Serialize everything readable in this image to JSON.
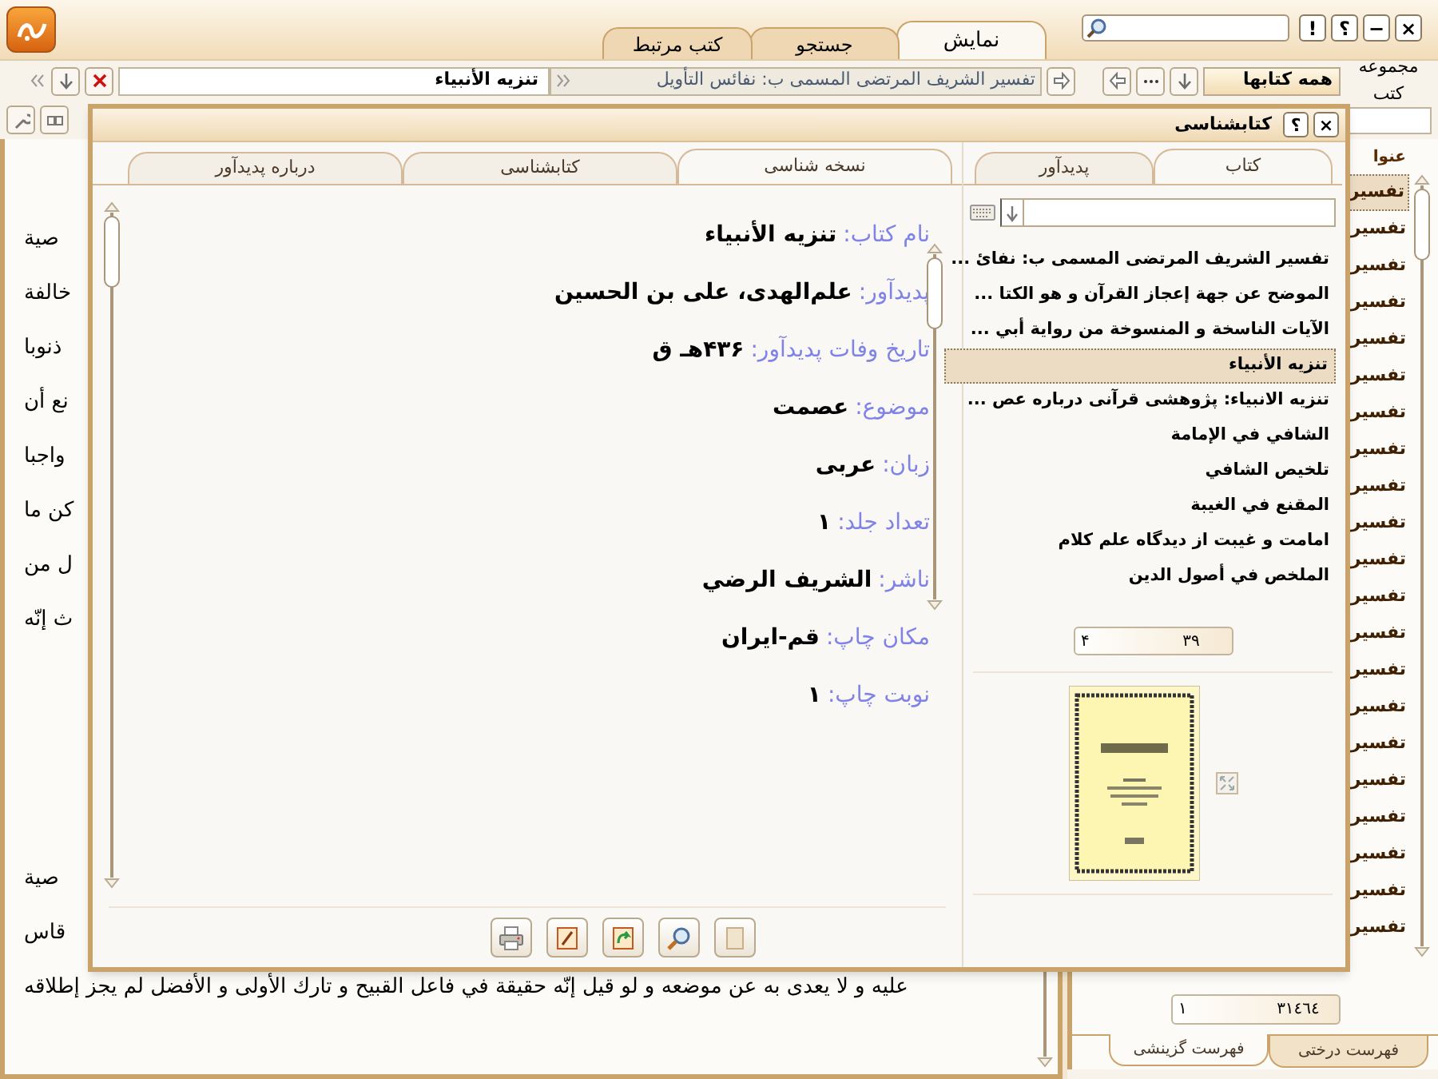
{
  "window_buttons": [
    "×",
    "−",
    "؟",
    "!"
  ],
  "top_tabs": [
    {
      "label": "نمایش",
      "selected": true
    },
    {
      "label": "جستجو",
      "selected": false
    },
    {
      "label": "کتب مرتبط",
      "selected": false
    }
  ],
  "collection": {
    "label": "مجموعه کتب",
    "value": "همه کتابها"
  },
  "open_book_title": "تفسير الشريف المرتضى المسمى ب: نفائس التأويل",
  "open_section": "تنزيه الأنبياء",
  "reading_pane": {
    "paragraphs": [
      [
        "صية",
        "خالفة",
        "ذنوبا",
        "نع أن",
        "واجبا",
        "كن ما",
        "ل من",
        "ث إنّه"
      ],
      [
        "صية",
        "قاس",
        "عليه و لا يعدى به عن موضعه و لو قيل إنّه حقيقة في فاعل القبيح و تارك الأولى و الأفضل لم يجز إطلاقه"
      ]
    ]
  },
  "index_panel": {
    "header": "عنوا",
    "rows": [
      {
        "text": "تفسير",
        "selected": true
      },
      {
        "text": "تفسير",
        "selected": false
      },
      {
        "text": "تفسير",
        "selected": false
      },
      {
        "text": "تفسير",
        "selected": false
      },
      {
        "text": "تفسير",
        "selected": false
      },
      {
        "text": "تفسير",
        "selected": false
      },
      {
        "text": "تفسير",
        "selected": false
      },
      {
        "text": "تفسير",
        "selected": false
      },
      {
        "text": "تفسير",
        "selected": false
      },
      {
        "text": "تفسير",
        "selected": false
      },
      {
        "text": "تفسير",
        "selected": false
      },
      {
        "text": "تفسير",
        "selected": false
      },
      {
        "text": "تفسير",
        "selected": false
      },
      {
        "text": "تفسير",
        "selected": false
      },
      {
        "text": "تفسير",
        "selected": false
      },
      {
        "text": "تفسير",
        "selected": false
      },
      {
        "text": "تفسير",
        "selected": false
      },
      {
        "text": "تفسير",
        "selected": false
      },
      {
        "text": "تفسير",
        "selected": false
      },
      {
        "text": "تفسير",
        "selected": false
      },
      {
        "text": "تفسير",
        "selected": false
      }
    ],
    "counter_total": "٣١٤٦٤",
    "counter_current": "١",
    "tabs": [
      {
        "label": "فهرست درختی",
        "selected": false
      },
      {
        "label": "فهرست گزینشی",
        "selected": true
      }
    ]
  },
  "dialog": {
    "title": "کتابشناسی",
    "buttons": [
      "×",
      "؟"
    ],
    "list_tabs": [
      {
        "label": "کتاب",
        "selected": true
      },
      {
        "label": "پدیدآور",
        "selected": false
      }
    ],
    "books": [
      {
        "title": "تفسير الشريف المرتضى المسمى ب: نفائ ...",
        "selected": false
      },
      {
        "title": "الموضح عن جهة إعجاز القرآن و هو الكتا ...",
        "selected": false
      },
      {
        "title": "الآيات الناسخة و المنسوخة من رواية أبي ...",
        "selected": false
      },
      {
        "title": "تنزيه الأنبياء",
        "selected": true
      },
      {
        "title": "تنزيه الانبياء: پژوهشی قرآنی درباره عص ...",
        "selected": false
      },
      {
        "title": "الشافي في الإمامة",
        "selected": false
      },
      {
        "title": "تلخيص الشافي",
        "selected": false
      },
      {
        "title": "المقنع في الغيبة",
        "selected": false
      },
      {
        "title": "امامت و غيبت از ديدگاه علم كلام",
        "selected": false
      },
      {
        "title": "الملخص في أصول الدين",
        "selected": false
      }
    ],
    "book_counter": {
      "total": "٣٩",
      "current": "۴"
    },
    "detail_tabs": [
      {
        "label": "نسخه شناسی",
        "selected": true
      },
      {
        "label": "کتابشناسی",
        "selected": false
      },
      {
        "label": "درباره پدیدآور",
        "selected": false
      }
    ],
    "fields": [
      {
        "label": "نام کتاب:",
        "value": "تنزيه الأنبياء"
      },
      {
        "label": "پدیدآور:",
        "value": "علم‌الهدی، علی بن الحسين"
      },
      {
        "label": "تاریخ وفات پدیدآور:",
        "value": "۴۳۶هـ ق"
      },
      {
        "label": "موضوع:",
        "value": "عصمت"
      },
      {
        "label": "زبان:",
        "value": "عربی"
      },
      {
        "label": "تعداد جلد:",
        "value": "۱"
      },
      {
        "label": "ناشر:",
        "value": "الشريف الرضي"
      },
      {
        "label": "مکان چاپ:",
        "value": "قم-ايران"
      },
      {
        "label": "نوبت چاپ:",
        "value": "۱"
      }
    ]
  }
}
